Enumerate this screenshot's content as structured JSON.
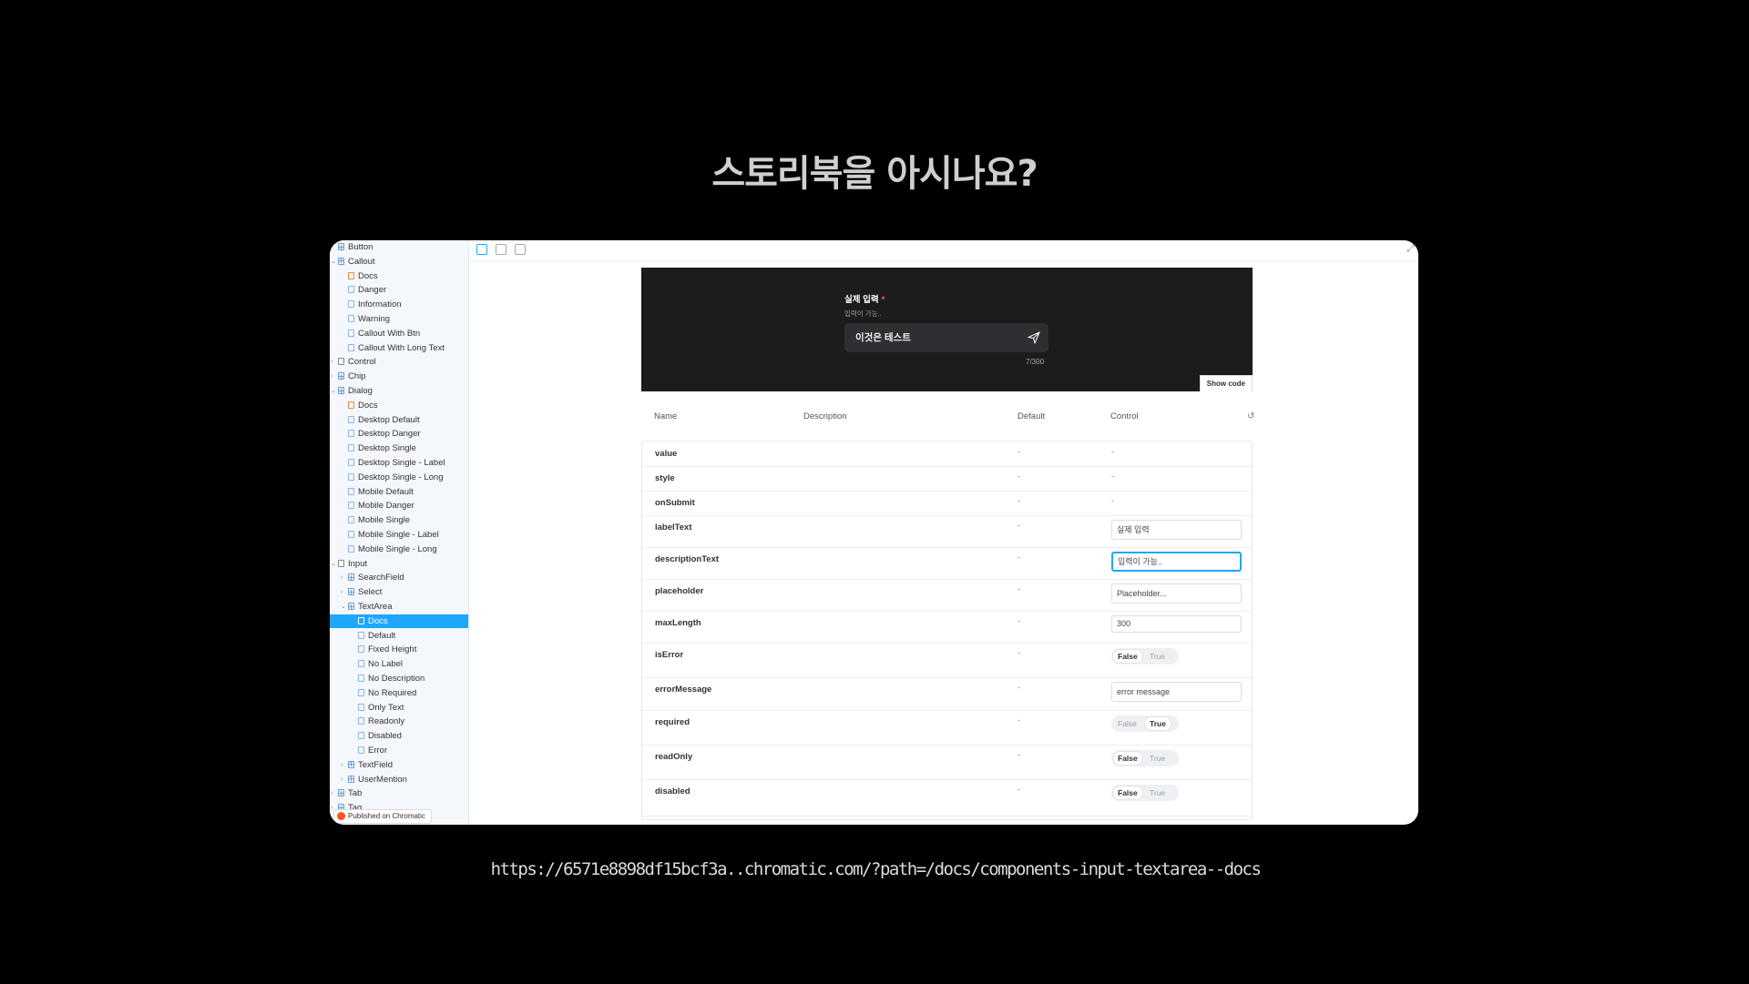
{
  "slide": {
    "title": "스토리북을 아시나요?",
    "url": "https://6571e8898df15bcf3a..chromatic.com/?path=/docs/components-input-textarea--docs"
  },
  "sidebar": {
    "items": [
      {
        "label": "Button",
        "kind": "component",
        "depth": 0,
        "caret": "›"
      },
      {
        "label": "Callout",
        "kind": "component",
        "depth": 0,
        "caret": "⌄"
      },
      {
        "label": "Docs",
        "kind": "docs",
        "depth": 1,
        "caret": ""
      },
      {
        "label": "Danger",
        "kind": "story",
        "depth": 1,
        "caret": ""
      },
      {
        "label": "Information",
        "kind": "story",
        "depth": 1,
        "caret": ""
      },
      {
        "label": "Warning",
        "kind": "story",
        "depth": 1,
        "caret": ""
      },
      {
        "label": "Callout With Btn",
        "kind": "story",
        "depth": 1,
        "caret": ""
      },
      {
        "label": "Callout With Long Text",
        "kind": "story",
        "depth": 1,
        "caret": ""
      },
      {
        "label": "Control",
        "kind": "folder",
        "depth": 0,
        "caret": "›"
      },
      {
        "label": "Chip",
        "kind": "component",
        "depth": 0,
        "caret": "›"
      },
      {
        "label": "Dialog",
        "kind": "component",
        "depth": 0,
        "caret": "⌄"
      },
      {
        "label": "Docs",
        "kind": "docs",
        "depth": 1,
        "caret": ""
      },
      {
        "label": "Desktop Default",
        "kind": "story",
        "depth": 1,
        "caret": ""
      },
      {
        "label": "Desktop Danger",
        "kind": "story",
        "depth": 1,
        "caret": ""
      },
      {
        "label": "Desktop Single",
        "kind": "story",
        "depth": 1,
        "caret": ""
      },
      {
        "label": "Desktop Single - Label",
        "kind": "story",
        "depth": 1,
        "caret": ""
      },
      {
        "label": "Desktop Single - Long",
        "kind": "story",
        "depth": 1,
        "caret": ""
      },
      {
        "label": "Mobile Default",
        "kind": "story",
        "depth": 1,
        "caret": ""
      },
      {
        "label": "Mobile Danger",
        "kind": "story",
        "depth": 1,
        "caret": ""
      },
      {
        "label": "Mobile Single",
        "kind": "story",
        "depth": 1,
        "caret": ""
      },
      {
        "label": "Mobile Single - Label",
        "kind": "story",
        "depth": 1,
        "caret": ""
      },
      {
        "label": "Mobile Single - Long",
        "kind": "story",
        "depth": 1,
        "caret": ""
      },
      {
        "label": "Input",
        "kind": "folder",
        "depth": 0,
        "caret": "⌄"
      },
      {
        "label": "SearchField",
        "kind": "component",
        "depth": 1,
        "caret": "›"
      },
      {
        "label": "Select",
        "kind": "component",
        "depth": 1,
        "caret": "›"
      },
      {
        "label": "TextArea",
        "kind": "component",
        "depth": 1,
        "caret": "⌄"
      },
      {
        "label": "Docs",
        "kind": "docs",
        "depth": 2,
        "caret": "",
        "selected": true
      },
      {
        "label": "Default",
        "kind": "story",
        "depth": 2,
        "caret": ""
      },
      {
        "label": "Fixed Height",
        "kind": "story",
        "depth": 2,
        "caret": ""
      },
      {
        "label": "No Label",
        "kind": "story",
        "depth": 2,
        "caret": ""
      },
      {
        "label": "No Description",
        "kind": "story",
        "depth": 2,
        "caret": ""
      },
      {
        "label": "No Required",
        "kind": "story",
        "depth": 2,
        "caret": ""
      },
      {
        "label": "Only Text",
        "kind": "story",
        "depth": 2,
        "caret": ""
      },
      {
        "label": "Readonly",
        "kind": "story",
        "depth": 2,
        "caret": ""
      },
      {
        "label": "Disabled",
        "kind": "story",
        "depth": 2,
        "caret": ""
      },
      {
        "label": "Error",
        "kind": "story",
        "depth": 2,
        "caret": ""
      },
      {
        "label": "TextField",
        "kind": "component",
        "depth": 1,
        "caret": "›"
      },
      {
        "label": "UserMention",
        "kind": "component",
        "depth": 1,
        "caret": "›"
      },
      {
        "label": "Tab",
        "kind": "component",
        "depth": 0,
        "caret": "›"
      },
      {
        "label": "Tag",
        "kind": "component",
        "depth": 0,
        "caret": "›"
      }
    ],
    "badge": "Published on Chromatic"
  },
  "preview": {
    "label": "실제 입력",
    "required_mark": "*",
    "description": "입력이 가능..",
    "value": "이것은 테스트",
    "counter": "7/300",
    "show_code": "Show code"
  },
  "args": {
    "headers": {
      "name": "Name",
      "description": "Description",
      "default": "Default",
      "control": "Control"
    },
    "rows": [
      {
        "name": "value",
        "default": "-",
        "control": {
          "type": "none",
          "value": "-"
        }
      },
      {
        "name": "style",
        "default": "-",
        "control": {
          "type": "none",
          "value": "-"
        }
      },
      {
        "name": "onSubmit",
        "default": "-",
        "control": {
          "type": "none",
          "value": "-"
        }
      },
      {
        "name": "labelText",
        "default": "-",
        "control": {
          "type": "text",
          "value": "실제 입력"
        }
      },
      {
        "name": "descriptionText",
        "default": "-",
        "control": {
          "type": "text",
          "value": "입력이 가능..",
          "focused": true
        }
      },
      {
        "name": "placeholder",
        "default": "-",
        "control": {
          "type": "text",
          "value": "Placeholder..."
        }
      },
      {
        "name": "maxLength",
        "default": "-",
        "control": {
          "type": "number",
          "value": "300"
        }
      },
      {
        "name": "isError",
        "default": "-",
        "control": {
          "type": "boolean",
          "false_label": "False",
          "true_label": "True",
          "value": false
        }
      },
      {
        "name": "errorMessage",
        "default": "-",
        "control": {
          "type": "text",
          "value": "error message"
        }
      },
      {
        "name": "required",
        "default": "-",
        "control": {
          "type": "boolean",
          "false_label": "False",
          "true_label": "True",
          "value": true
        }
      },
      {
        "name": "readOnly",
        "default": "-",
        "control": {
          "type": "boolean",
          "false_label": "False",
          "true_label": "True",
          "value": false
        }
      },
      {
        "name": "disabled",
        "default": "-",
        "control": {
          "type": "boolean",
          "false_label": "False",
          "true_label": "True",
          "value": false
        }
      }
    ]
  },
  "colors": {
    "accent": "#1ea7fd",
    "preview_bg": "#1c1c1e",
    "sidebar_bg": "#f4f7fb"
  }
}
